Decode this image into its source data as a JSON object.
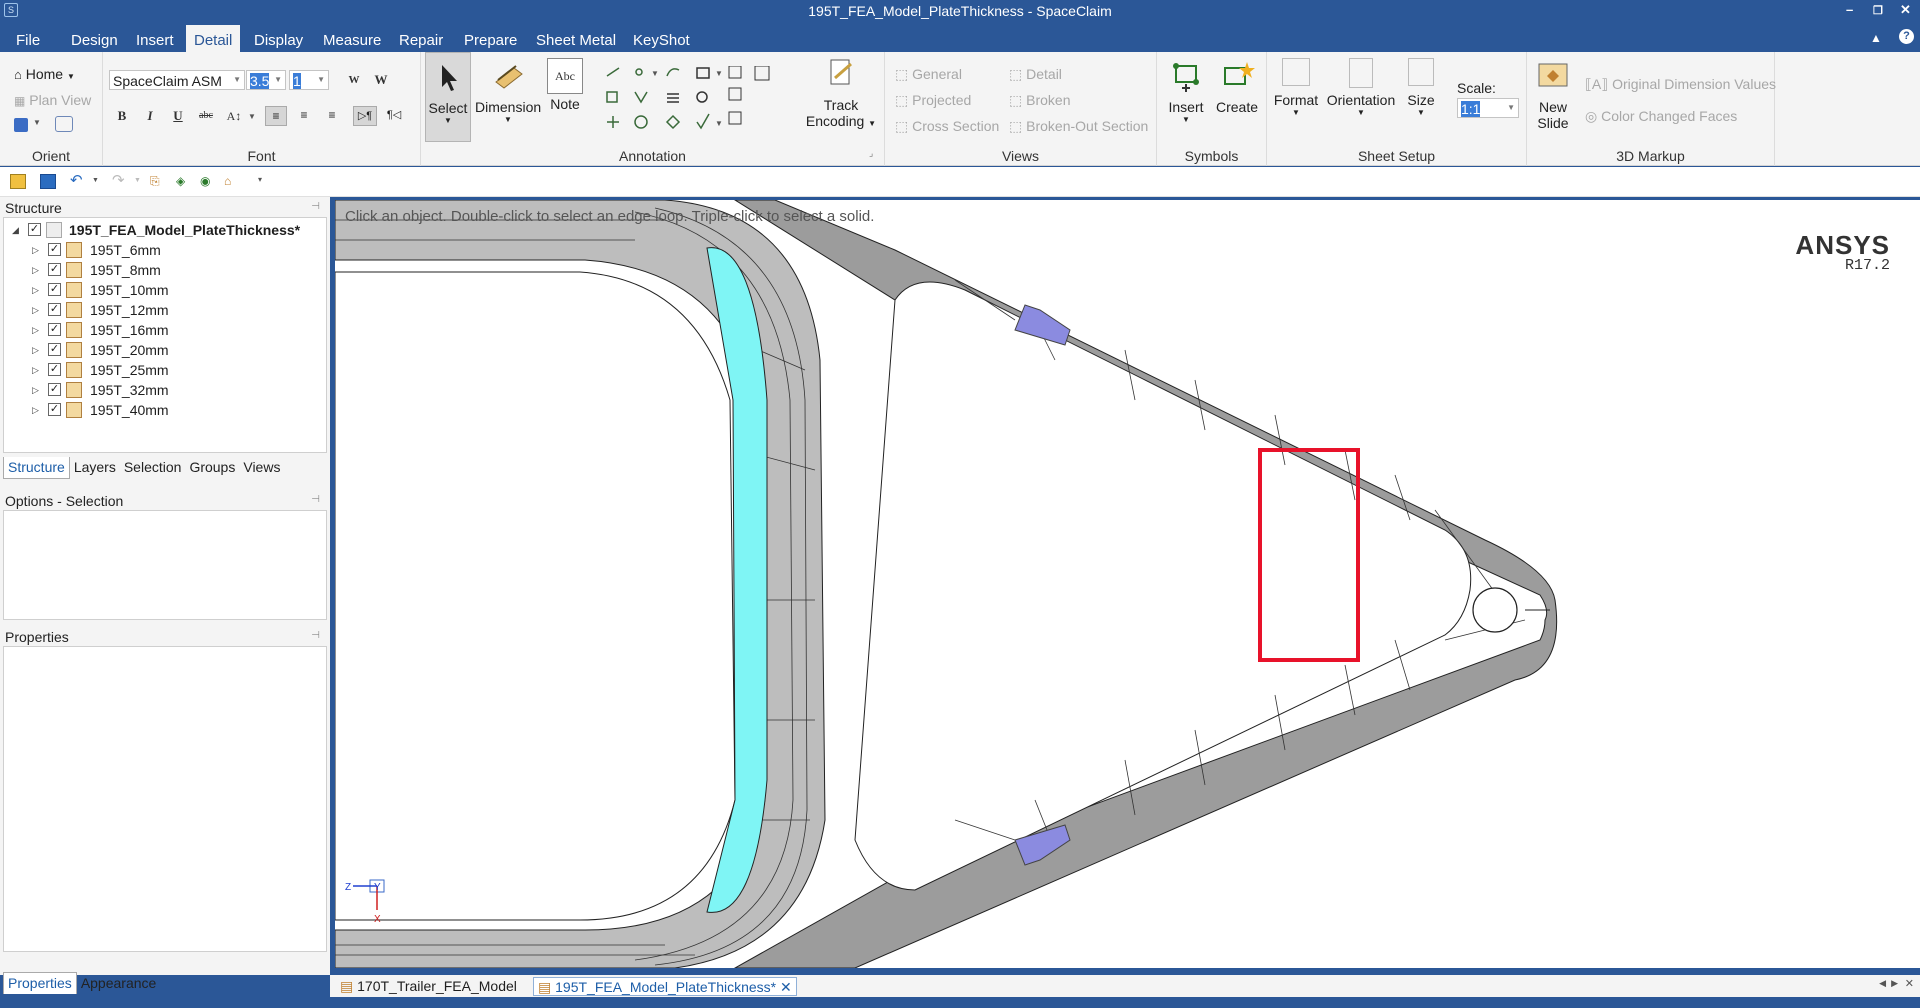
{
  "window": {
    "title": "195T_FEA_Model_PlateThickness - SpaceClaim"
  },
  "menu": {
    "tabs": [
      "File",
      "Design",
      "Insert",
      "Detail",
      "Display",
      "Measure",
      "Repair",
      "Prepare",
      "Sheet Metal",
      "KeyShot"
    ],
    "active": "Detail"
  },
  "ribbon": {
    "orient": {
      "label": "Orient",
      "home": "Home",
      "plan_view": "Plan View"
    },
    "font": {
      "label": "Font",
      "family": "SpaceClaim ASM",
      "size": "3.5",
      "ratio": "1",
      "bold": "B",
      "italic": "I",
      "underline": "U",
      "strike": "abc",
      "w1": "W",
      "w2": "W"
    },
    "annotation": {
      "label": "Annotation",
      "select": "Select",
      "dimension": "Dimension",
      "note": "Note",
      "note_icon_text": "Abc",
      "track1": "Track",
      "track2": "Encoding"
    },
    "views": {
      "label": "Views",
      "general": "General",
      "projected": "Projected",
      "cross_section": "Cross Section",
      "detail": "Detail",
      "broken": "Broken",
      "broken_out": "Broken-Out Section"
    },
    "symbols": {
      "label": "Symbols",
      "insert": "Insert",
      "create": "Create"
    },
    "sheet_setup": {
      "label": "Sheet Setup",
      "format": "Format",
      "orientation": "Orientation",
      "size": "Size",
      "scale_label": "Scale:",
      "scale_value": "1:1"
    },
    "markup": {
      "label": "3D Markup",
      "new_slide1": "New",
      "new_slide2": "Slide",
      "orig_dims": "Original Dimension Values",
      "color_changed": "Color Changed Faces"
    }
  },
  "structure": {
    "title": "Structure",
    "root": "195T_FEA_Model_PlateThickness*",
    "items": [
      "195T_6mm",
      "195T_8mm",
      "195T_10mm",
      "195T_12mm",
      "195T_16mm",
      "195T_20mm",
      "195T_25mm",
      "195T_32mm",
      "195T_40mm"
    ],
    "tabs": [
      "Structure",
      "Layers",
      "Selection",
      "Groups",
      "Views"
    ]
  },
  "options": {
    "title": "Options - Selection"
  },
  "properties": {
    "title": "Properties",
    "tabs": [
      "Properties",
      "Appearance"
    ]
  },
  "viewport": {
    "hint": "Click an object. Double-click to select an edge loop. Triple-click to select a solid.",
    "brand": "ANSYS",
    "version": "R17.2",
    "triad": {
      "z": "Z",
      "y": "Y",
      "x": "X"
    }
  },
  "documents": {
    "tabs": [
      "170T_Trailer_FEA_Model",
      "195T_FEA_Model_PlateThickness*"
    ],
    "active": 1
  },
  "colors": {
    "titlebar": "#2b5797",
    "highlight_box": "#e8122a",
    "cyan_face": "#7ff5f5",
    "mesh_gray": "#9c9c9c",
    "bolt": "#8b8be0"
  }
}
